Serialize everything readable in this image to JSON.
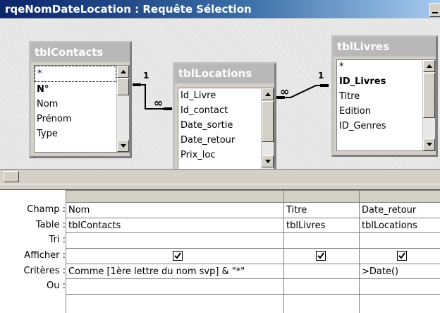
{
  "window": {
    "title": "rqeNomDateLocation : Requête Sélection"
  },
  "tables": [
    {
      "name": "tblContacts",
      "fields": [
        "*",
        "N°",
        "Nom",
        "Prénom",
        "Type"
      ]
    },
    {
      "name": "tblLocations",
      "fields": [
        "Id_Livre",
        "Id_contact",
        "Date_sortie",
        "Date_retour",
        "Prix_loc"
      ]
    },
    {
      "name": "tblLivres",
      "fields": [
        "*",
        "ID_Livres",
        "Titre",
        "Edition",
        "ID_Genres"
      ]
    }
  ],
  "relations": [
    {
      "from": "tblContacts",
      "to": "tblLocations",
      "one": "1",
      "many": "∞"
    },
    {
      "from": "tblLocations",
      "to": "tblLivres",
      "one": "1",
      "many": "∞"
    }
  ],
  "grid": {
    "row_labels": [
      "Champ :",
      "Table :",
      "Tri :",
      "Afficher :",
      "Critères :",
      "Ou :"
    ],
    "columns": [
      {
        "champ": "Nom",
        "table": "tblContacts",
        "tri": "",
        "afficher": true,
        "criteres": "Comme [1ère lettre du nom svp] & \"*\"",
        "ou": ""
      },
      {
        "champ": "Titre",
        "table": "tblLivres",
        "tri": "",
        "afficher": true,
        "criteres": "",
        "ou": ""
      },
      {
        "champ": "Date_retour",
        "table": "tblLocations",
        "tri": "",
        "afficher": true,
        "criteres": ">Date()",
        "ou": ""
      }
    ]
  }
}
